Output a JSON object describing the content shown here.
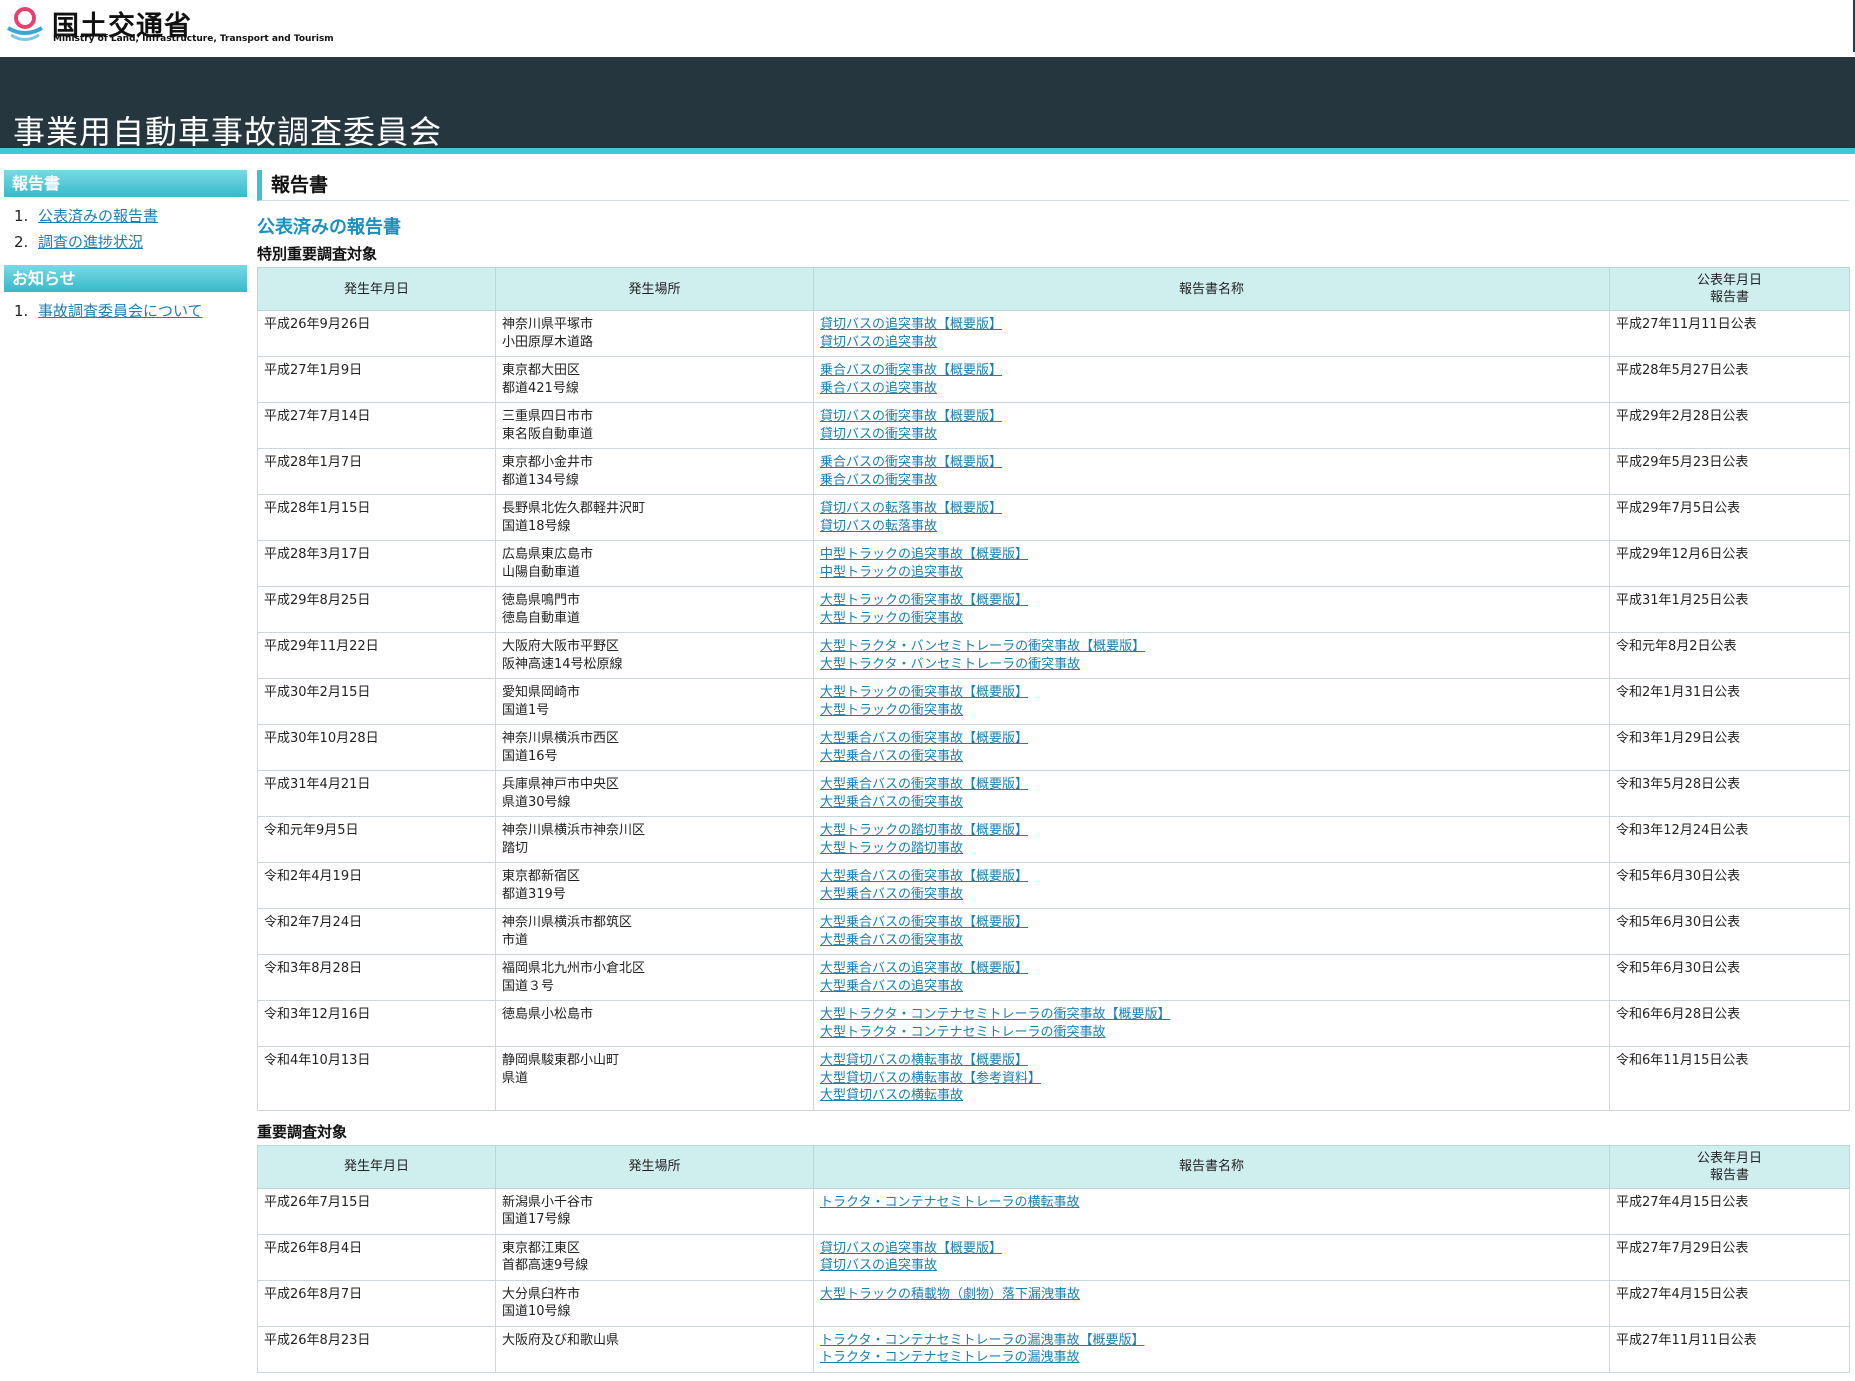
{
  "header": {
    "logo_ja": "国土交通省",
    "logo_en": "Ministry of Land, Infrastructure, Transport and Tourism",
    "banner_title": "事業用自動車事故調査委員会"
  },
  "sidebar": {
    "sections": [
      {
        "title": "報告書",
        "items": [
          {
            "num": "1.",
            "label": "公表済みの報告書"
          },
          {
            "num": "2.",
            "label": "調査の進捗状況"
          }
        ]
      },
      {
        "title": "お知らせ",
        "items": [
          {
            "num": "1.",
            "label": "事故調査委員会について"
          }
        ]
      }
    ]
  },
  "main": {
    "page_title": "報告書",
    "section_title": "公表済みの報告書",
    "columns": [
      "発生年月日",
      "発生場所",
      "報告書名称",
      "公表年月日\n報告書"
    ],
    "tables": [
      {
        "title": "特別重要調査対象",
        "rows": [
          {
            "date": "平成26年9月26日",
            "place": [
              "神奈川県平塚市",
              "小田原厚木道路"
            ],
            "reports": [
              "貸切バスの追突事故【概要版】",
              "貸切バスの追突事故"
            ],
            "published": "平成27年11月11日公表"
          },
          {
            "date": "平成27年1月9日",
            "place": [
              "東京都大田区",
              "都道421号線"
            ],
            "reports": [
              "乗合バスの衝突事故【概要版】",
              "乗合バスの追突事故"
            ],
            "published": "平成28年5月27日公表"
          },
          {
            "date": "平成27年7月14日",
            "place": [
              "三重県四日市市",
              "東名阪自動車道"
            ],
            "reports": [
              "貸切バスの衝突事故【概要版】",
              "貸切バスの衝突事故"
            ],
            "published": "平成29年2月28日公表"
          },
          {
            "date": "平成28年1月7日",
            "place": [
              "東京都小金井市",
              "都道134号線"
            ],
            "reports": [
              "乗合バスの衝突事故【概要版】",
              "乗合バスの衝突事故"
            ],
            "published": "平成29年5月23日公表"
          },
          {
            "date": "平成28年1月15日",
            "place": [
              "長野県北佐久郡軽井沢町",
              "国道18号線"
            ],
            "reports": [
              "貸切バスの転落事故【概要版】",
              "貸切バスの転落事故"
            ],
            "published": "平成29年7月5日公表"
          },
          {
            "date": "平成28年3月17日",
            "place": [
              "広島県東広島市",
              "山陽自動車道"
            ],
            "reports": [
              "中型トラックの追突事故【概要版】",
              "中型トラックの追突事故"
            ],
            "published": "平成29年12月6日公表"
          },
          {
            "date": "平成29年8月25日",
            "place": [
              "徳島県鳴門市",
              "徳島自動車道"
            ],
            "reports": [
              "大型トラックの衝突事故【概要版】",
              "大型トラックの衝突事故"
            ],
            "published": "平成31年1月25日公表"
          },
          {
            "date": "平成29年11月22日",
            "place": [
              "大阪府大阪市平野区",
              "阪神高速14号松原線"
            ],
            "reports": [
              "大型トラクタ・バンセミトレーラの衝突事故【概要版】",
              "大型トラクタ・バンセミトレーラの衝突事故"
            ],
            "published": "令和元年8月2日公表"
          },
          {
            "date": "平成30年2月15日",
            "place": [
              "愛知県岡崎市",
              "国道1号"
            ],
            "reports": [
              "大型トラックの衝突事故【概要版】",
              "大型トラックの衝突事故"
            ],
            "published": "令和2年1月31日公表"
          },
          {
            "date": "平成30年10月28日",
            "place": [
              "神奈川県横浜市西区",
              "国道16号"
            ],
            "reports": [
              "大型乗合バスの衝突事故【概要版】",
              "大型乗合バスの衝突事故"
            ],
            "published": "令和3年1月29日公表"
          },
          {
            "date": "平成31年4月21日",
            "place": [
              "兵庫県神戸市中央区",
              "県道30号線"
            ],
            "reports": [
              "大型乗合バスの衝突事故【概要版】",
              "大型乗合バスの衝突事故"
            ],
            "published": "令和3年5月28日公表"
          },
          {
            "date": "令和元年9月5日",
            "place": [
              "神奈川県横浜市神奈川区",
              "踏切"
            ],
            "reports": [
              "大型トラックの踏切事故【概要版】",
              "大型トラックの踏切事故"
            ],
            "published": "令和3年12月24日公表"
          },
          {
            "date": "令和2年4月19日",
            "place": [
              "東京都新宿区",
              "都道319号"
            ],
            "reports": [
              "大型乗合バスの衝突事故【概要版】",
              "大型乗合バスの衝突事故"
            ],
            "published": "令和5年6月30日公表"
          },
          {
            "date": "令和2年7月24日",
            "place": [
              "神奈川県横浜市都筑区",
              "市道"
            ],
            "reports": [
              "大型乗合バスの衝突事故【概要版】",
              "大型乗合バスの衝突事故"
            ],
            "published": "令和5年6月30日公表"
          },
          {
            "date": "令和3年8月28日",
            "place": [
              "福岡県北九州市小倉北区",
              "国道３号"
            ],
            "reports": [
              "大型乗合バスの追突事故【概要版】",
              "大型乗合バスの追突事故"
            ],
            "published": "令和5年6月30日公表"
          },
          {
            "date": "令和3年12月16日",
            "place": [
              "徳島県小松島市"
            ],
            "reports": [
              "大型トラクタ・コンテナセミトレーラの衝突事故【概要版】",
              "大型トラクタ・コンテナセミトレーラの衝突事故"
            ],
            "published": "令和6年6月28日公表"
          },
          {
            "date": "令和4年10月13日",
            "place": [
              "静岡県駿東郡小山町",
              "県道"
            ],
            "reports": [
              "大型貸切バスの横転事故【概要版】",
              "大型貸切バスの横転事故【参考資料】",
              "大型貸切バスの横転事故"
            ],
            "published": "令和6年11月15日公表"
          }
        ]
      },
      {
        "title": "重要調査対象",
        "rows": [
          {
            "date": "平成26年7月15日",
            "place": [
              "新潟県小千谷市",
              "国道17号線"
            ],
            "reports": [
              "トラクタ・コンテナセミトレーラの横転事故"
            ],
            "published": "平成27年4月15日公表"
          },
          {
            "date": "平成26年8月4日",
            "place": [
              "東京都江東区",
              "首都高速9号線"
            ],
            "reports": [
              "貸切バスの追突事故【概要版】",
              "貸切バスの追突事故"
            ],
            "published": "平成27年7月29日公表"
          },
          {
            "date": "平成26年8月7日",
            "place": [
              "大分県臼杵市",
              "国道10号線"
            ],
            "reports": [
              "大型トラックの積載物（劇物）落下漏洩事故"
            ],
            "published": "平成27年4月15日公表"
          },
          {
            "date": "平成26年8月23日",
            "place": [
              "大阪府及び和歌山県"
            ],
            "reports": [
              "トラクタ・コンテナセミトレーラの漏洩事故【概要版】",
              "トラクタ・コンテナセミトレーラの漏洩事故"
            ],
            "published": "平成27年11月11日公表"
          }
        ]
      }
    ]
  }
}
